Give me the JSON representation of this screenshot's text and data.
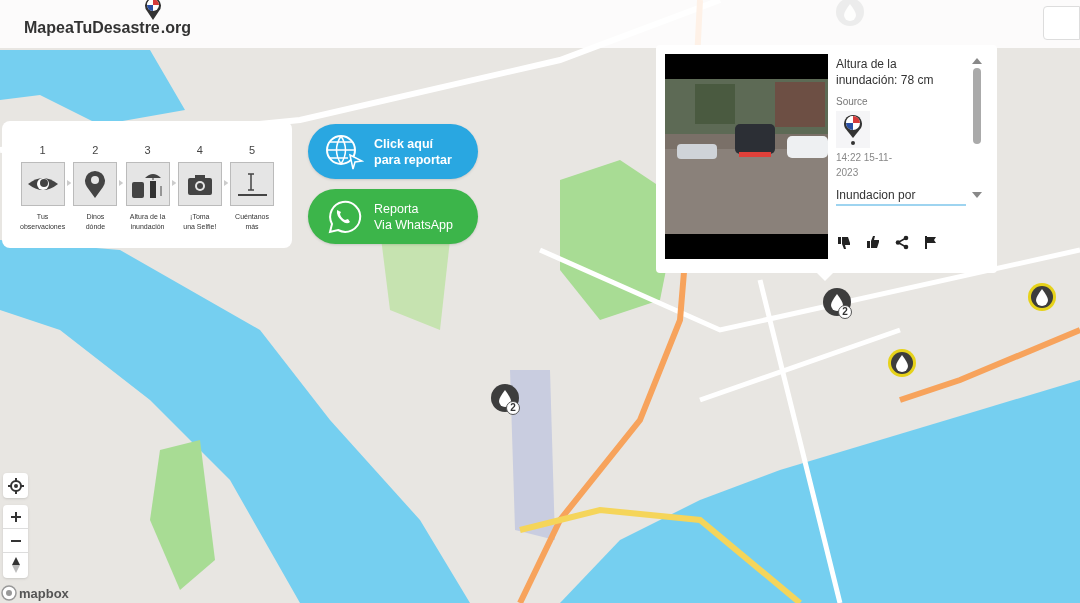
{
  "header": {
    "logo_name": "MapeaTuDesastre",
    "logo_tld": ".org"
  },
  "steps": [
    {
      "number": "1",
      "lines": [
        "Tus",
        "observaciones"
      ],
      "kind": "eye"
    },
    {
      "number": "2",
      "lines": [
        "Dinos",
        "dónde"
      ],
      "kind": "pin"
    },
    {
      "number": "3",
      "lines": [
        "Altura de la",
        "inundación"
      ],
      "kind": "height"
    },
    {
      "number": "4",
      "lines": [
        "¡Toma",
        "una Selfie!"
      ],
      "kind": "camera"
    },
    {
      "number": "5",
      "lines": [
        "Cuéntanos",
        "más"
      ],
      "kind": "text"
    }
  ],
  "report_buttons": [
    {
      "kind": "web",
      "lines": [
        "Click aquí",
        "para reportar"
      ]
    },
    {
      "kind": "whatsapp",
      "lines": [
        "Reporta",
        "Via WhatsApp"
      ]
    }
  ],
  "popup": {
    "title": "Altura de la inundación: 78 cm",
    "source_label": "Source",
    "timestamp": "14:22 15-11-2023",
    "description": "Inundacion por",
    "actions": [
      {
        "kind": "dislike"
      },
      {
        "kind": "like"
      },
      {
        "kind": "share"
      },
      {
        "kind": "flag"
      }
    ]
  },
  "markers": [
    {
      "kind": "single"
    },
    {
      "kind": "cluster",
      "count": "2"
    },
    {
      "kind": "cluster",
      "count": "2"
    },
    {
      "kind": "highlighted"
    },
    {
      "kind": "highlighted"
    }
  ],
  "map_credit": "mapbox"
}
